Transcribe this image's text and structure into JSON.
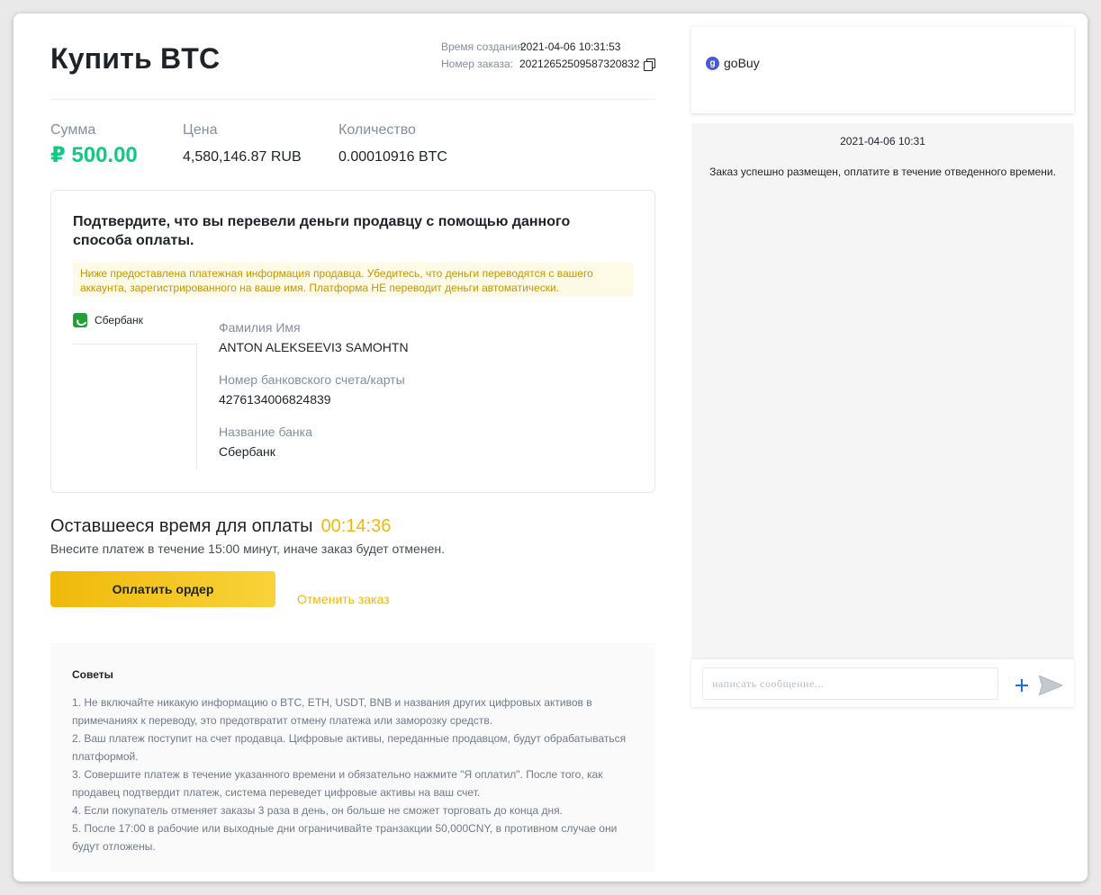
{
  "header": {
    "title": "Купить BTC",
    "created_label": "Время создания:",
    "created_value": "2021-04-06 10:31:53",
    "order_label": "Номер заказа:",
    "order_value": "20212652509587320832"
  },
  "stats": {
    "sum_label": "Сумма",
    "sum_value": "₽ 500.00",
    "price_label": "Цена",
    "price_value": "4,580,146.87 RUB",
    "qty_label": "Количество",
    "qty_value": "0.00010916 BTC"
  },
  "payment": {
    "title": "Подтвердите, что вы перевели деньги продавцу с помощью данного способа оплаты.",
    "warning": "Ниже предоставлена платежная информация продавца. Убедитесь, что деньги переводятся с вашего аккаунта, зарегистрированного на ваше имя. Платформа НЕ переводит деньги автоматически.",
    "method": "Сбербанк",
    "fields": [
      {
        "label": "Фамилия Имя",
        "value": "ANTON ALEKSEEVI3 SAMOHTN"
      },
      {
        "label": "Номер банковского счета/карты",
        "value": "4276134006824839"
      },
      {
        "label": "Название банка",
        "value": "Сбербанк"
      }
    ]
  },
  "timer": {
    "label": "Оставшееся время для оплаты",
    "value": "00:14:36",
    "note": "Внесите платеж в течение 15:00 минут, иначе заказ будет отменен."
  },
  "actions": {
    "pay_label": "Оплатить ордер",
    "cancel_label": "Отменить заказ"
  },
  "tips": {
    "title": "Советы",
    "items": [
      "1. Не включайте никакую информацию о BTC, ETH, USDT, BNB и названия других цифровых активов в примечаниях к переводу, это предотвратит отмену платежа или заморозку средств.",
      "2. Ваш платеж поступит на счет продавца. Цифровые активы, переданные продавцом, будут обрабатываться платформой.",
      "3. Совершите платеж в течение указанного времени и обязательно нажмите \"Я оплатил\". После того, как продавец подтвердит платеж, система переведет цифровые активы на ваш счет.",
      "4. Если покупатель отменяет заказы 3 раза в день, он больше не сможет торговать до конца дня.",
      "5. После 17:00 в рабочие или выходные дни ограничивайте транзакции 50,000CNY, в противном случае они будут отложены."
    ]
  },
  "chat": {
    "merchant_icon_letter": "g",
    "merchant_name": "goBuy",
    "date": "2021-04-06 10:31",
    "message": "Заказ успешно размещен, оплатите в течение отведенного времени.",
    "input_placeholder": "написать сообщение..."
  },
  "colors": {
    "accent": "#f0b90b",
    "sum_green": "#0ecb81",
    "warning_bg": "#fdfbe6",
    "link_blue": "#1c6fe3"
  }
}
